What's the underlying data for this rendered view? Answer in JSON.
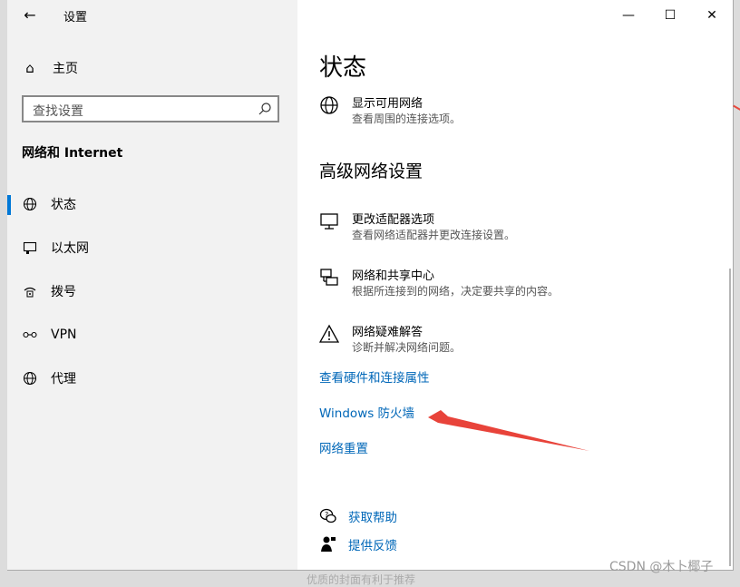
{
  "window": {
    "title": "设置"
  },
  "controls": {
    "minimize": "—",
    "maximize": "☐",
    "close": "✕"
  },
  "sidebar": {
    "home_label": "主页",
    "search_placeholder": "查找设置",
    "section_title": "网络和 Internet",
    "items": [
      {
        "label": "状态",
        "icon": "globe-icon",
        "active": true
      },
      {
        "label": "以太网",
        "icon": "ethernet-icon",
        "active": false
      },
      {
        "label": "拨号",
        "icon": "dialup-icon",
        "active": false
      },
      {
        "label": "VPN",
        "icon": "vpn-icon",
        "active": false
      },
      {
        "label": "代理",
        "icon": "proxy-globe-icon",
        "active": false
      }
    ]
  },
  "main": {
    "title": "状态",
    "show_networks": {
      "title": "显示可用网络",
      "subtitle": "查看周围的连接选项。"
    },
    "advanced_title": "高级网络设置",
    "advanced_items": [
      {
        "title": "更改适配器选项",
        "subtitle": "查看网络适配器并更改连接设置。",
        "icon": "monitor-icon"
      },
      {
        "title": "网络和共享中心",
        "subtitle": "根据所连接到的网络，决定要共享的内容。",
        "icon": "sharing-icon"
      },
      {
        "title": "网络疑难解答",
        "subtitle": "诊断并解决网络问题。",
        "icon": "warning-icon"
      }
    ],
    "links": [
      "查看硬件和连接属性",
      "Windows 防火墙",
      "网络重置"
    ],
    "help": {
      "get_help": "获取帮助",
      "feedback": "提供反馈"
    }
  },
  "watermark": "CSDN @木卜椰子",
  "below_text": "优质的封面有利于推荐",
  "colors": {
    "accent": "#0078d7",
    "link": "#0067b8",
    "arrow": "#e8433a"
  }
}
